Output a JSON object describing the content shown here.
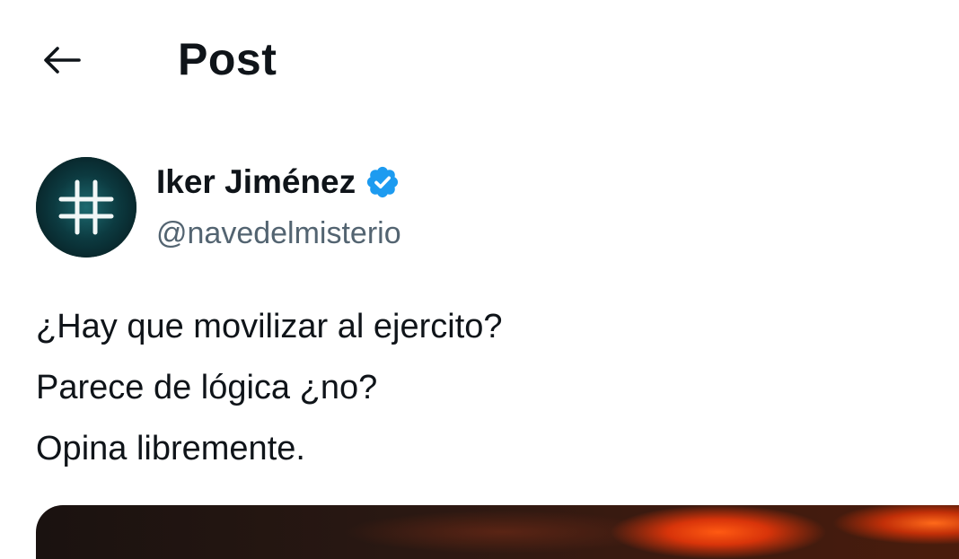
{
  "header": {
    "back_icon": "arrow-left-icon",
    "title": "Post"
  },
  "author": {
    "avatar_icon": "hash-grid-icon",
    "name": "Iker Jiménez",
    "verified_icon": "verified-badge-icon",
    "handle": "@navedelmisterio"
  },
  "post": {
    "lines": [
      "¿Hay que movilizar al ejercito?",
      "Parece de lógica ¿no?",
      "Opina libremente."
    ]
  },
  "colors": {
    "text_primary": "#0f1419",
    "text_secondary": "#536471",
    "verified_blue": "#1d9bf0"
  }
}
